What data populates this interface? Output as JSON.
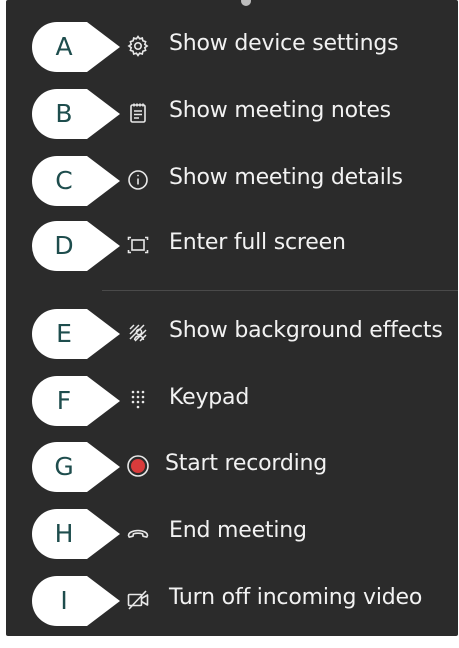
{
  "menu": {
    "items": [
      {
        "badge": "A",
        "label": "Show device settings",
        "icon": "gear-icon"
      },
      {
        "badge": "B",
        "label": "Show meeting notes",
        "icon": "notes-icon"
      },
      {
        "badge": "C",
        "label": "Show meeting details",
        "icon": "info-icon"
      },
      {
        "badge": "D",
        "label": "Enter full screen",
        "icon": "fullscreen-icon"
      },
      {
        "badge": "E",
        "label": "Show background effects",
        "icon": "background-effects-icon"
      },
      {
        "badge": "F",
        "label": "Keypad",
        "icon": "keypad-icon"
      },
      {
        "badge": "G",
        "label": "Start recording",
        "icon": "record-icon"
      },
      {
        "badge": "H",
        "label": "End meeting",
        "icon": "hang-up-icon"
      },
      {
        "badge": "I",
        "label": "Turn off incoming video",
        "icon": "video-off-icon"
      }
    ]
  },
  "colors": {
    "menu_background": "#2b2b2b",
    "text": "#f2f2f2",
    "badge_fill": "#ffffff",
    "badge_letter": "#1e4d4d",
    "record_red": "#d83b3b"
  }
}
